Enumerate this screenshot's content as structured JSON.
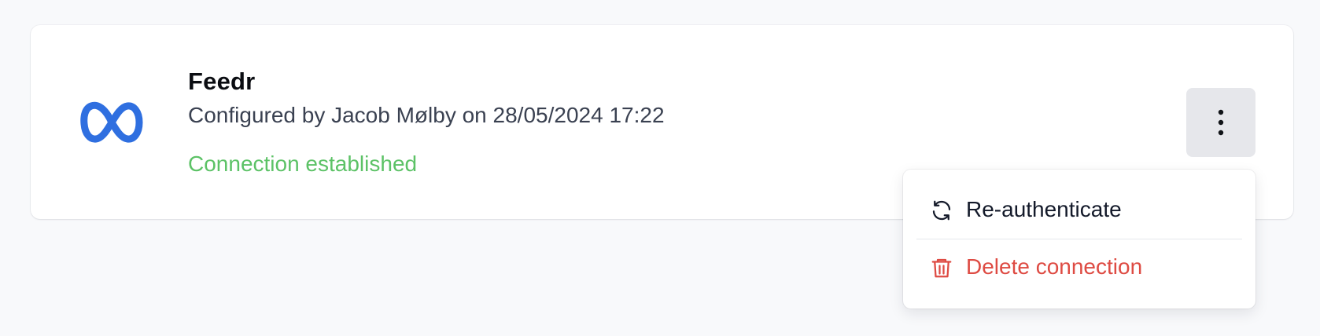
{
  "connection": {
    "name": "Feedr",
    "configured_text": "Configured by Jacob Mølby on 28/05/2024 17:22",
    "status": "Connection established",
    "logo_icon": "meta-logo-icon",
    "brand_color": "#2f6fe0",
    "status_color": "#5cc266"
  },
  "actions_button": {
    "icon": "more-vertical-icon"
  },
  "menu": {
    "items": [
      {
        "label": "Re-authenticate",
        "icon": "refresh-icon",
        "color": "#141a2a"
      },
      {
        "label": "Delete connection",
        "icon": "trash-icon",
        "color": "#de4b43"
      }
    ]
  }
}
